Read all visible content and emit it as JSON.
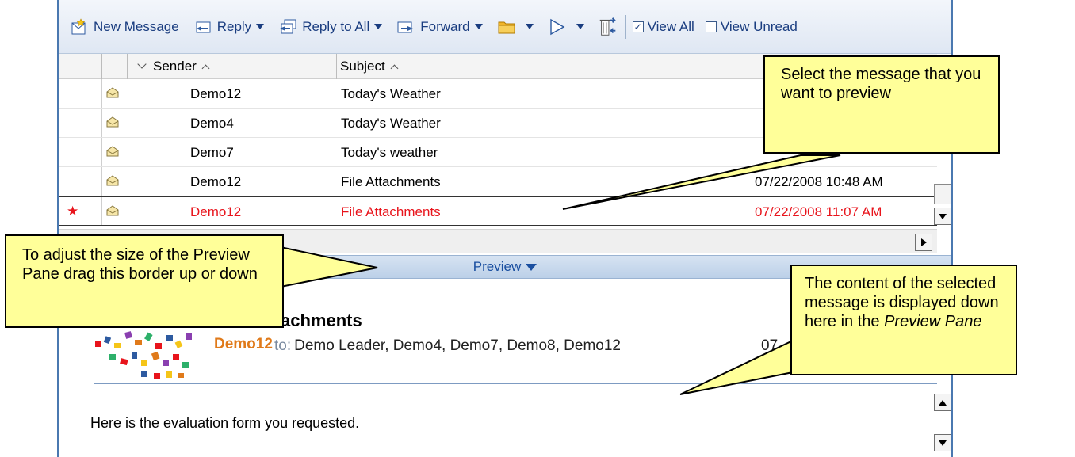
{
  "toolbar": {
    "new_message": "New Message",
    "reply": "Reply",
    "reply_all": "Reply to All",
    "forward": "Forward",
    "view_all": "View All",
    "view_unread": "View Unread"
  },
  "list_header": {
    "sender": "Sender",
    "subject": "Subject"
  },
  "messages": [
    {
      "sender": "Demo12",
      "subject": "Today's Weather",
      "date": ""
    },
    {
      "sender": "Demo4",
      "subject": "Today's Weather",
      "date": ""
    },
    {
      "sender": "Demo7",
      "subject": "Today's weather",
      "date": ""
    },
    {
      "sender": "Demo12",
      "subject": "File Attachments",
      "date": "07/22/2008 10:48 AM"
    },
    {
      "sender": "Demo12",
      "subject": "File Attachments",
      "date": "07/22/2008 11:07 AM",
      "selected": true,
      "flag": "★"
    }
  ],
  "preview_bar": {
    "label": "Preview"
  },
  "preview": {
    "subject": "achments",
    "from": "Demo12",
    "to_label": "to:",
    "to": "Demo Leader, Demo4, Demo7, Demo8, Demo12",
    "date_stub": "07",
    "body": "Here is the evaluation form you requested."
  },
  "callouts": {
    "select": "Select the message that you want to preview",
    "adjust": "To adjust the size of the Preview Pane drag this border up or down",
    "content_prefix": "The content of the selected message is displayed down here in the ",
    "content_italic": "Preview Pane"
  },
  "colors": {
    "selected_text": "#e8141c",
    "callout_fill": "#ffff99",
    "toolbar_text": "#1a3d80",
    "sender_name": "#e07a1a"
  }
}
